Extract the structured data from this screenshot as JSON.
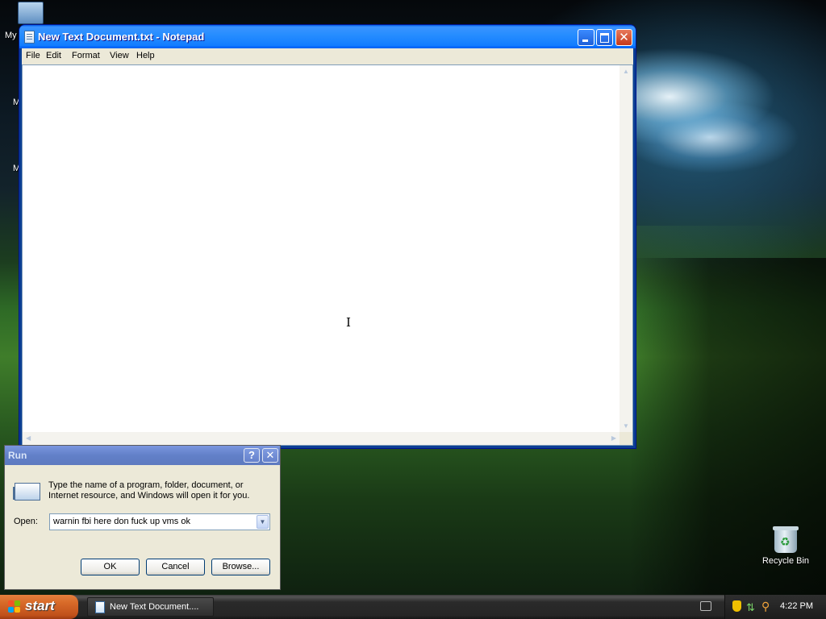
{
  "desktop": {
    "icons": [
      {
        "label": "My"
      },
      {
        "label": "M"
      },
      {
        "label": "M"
      },
      {
        "label": "Recycle Bin"
      }
    ]
  },
  "notepad": {
    "title": "New Text Document.txt - Notepad",
    "menu": [
      "File",
      "Edit",
      "Format",
      "View",
      "Help"
    ],
    "content": "",
    "icons": {
      "app": "notepad-icon",
      "minimize": "minimize-icon",
      "maximize": "maximize-icon",
      "close": "close-icon"
    }
  },
  "run_dialog": {
    "title": "Run",
    "help_glyph": "?",
    "close_glyph": "✕",
    "description": "Type the name of a program, folder, document, or Internet resource, and Windows will open it for you.",
    "open_label": "Open:",
    "open_value": "warnin fbi here don fuck up vms ok",
    "buttons": {
      "ok": "OK",
      "cancel": "Cancel",
      "browse": "Browse..."
    },
    "icon": "run-icon"
  },
  "taskbar": {
    "start_label": "start",
    "tasks": [
      {
        "label": "New Text Document....",
        "icon": "notepad-icon"
      }
    ],
    "clock": "4:22 PM",
    "tray_icons": [
      "keyboard-icon",
      "security-shield-icon",
      "network-icon",
      "search-icon"
    ]
  },
  "colors": {
    "xp_blue_title": "#0a5ad9",
    "start_orange": "#d96c2a",
    "dialog_face": "#ece9d8"
  }
}
